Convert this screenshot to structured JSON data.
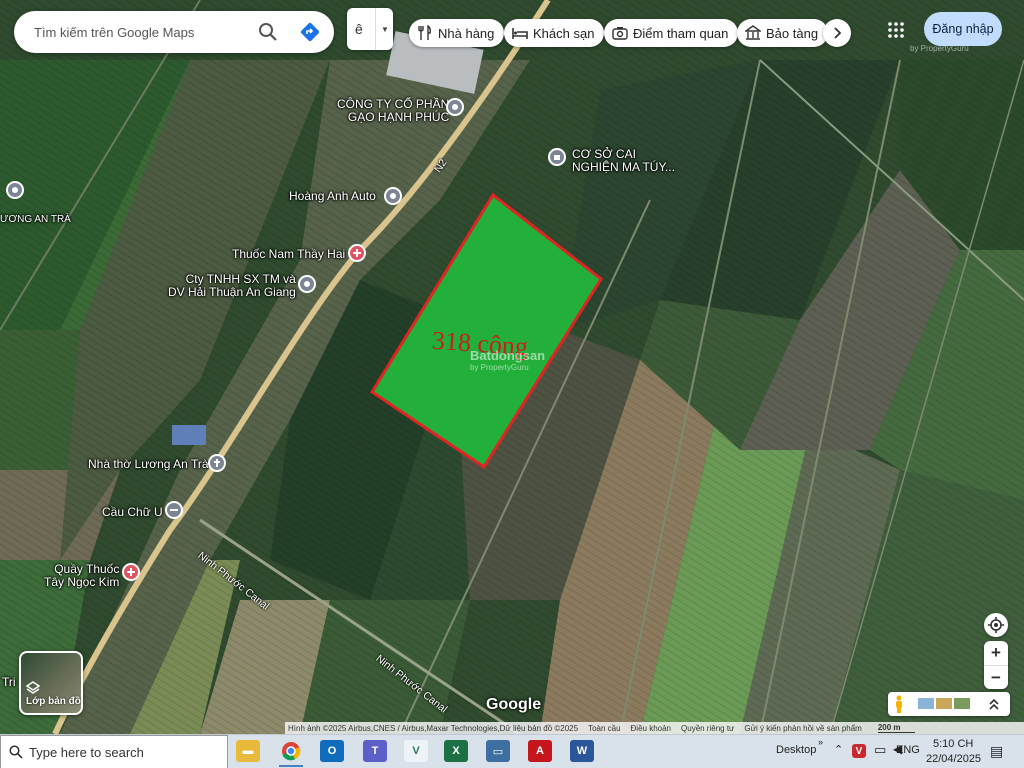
{
  "search": {
    "placeholder": "Tìm kiếm trên Google Maps"
  },
  "language_button": {
    "label": "ê"
  },
  "categories": [
    {
      "label": "Nhà hàng",
      "icon": "restaurant-icon"
    },
    {
      "label": "Khách sạn",
      "icon": "hotel-icon"
    },
    {
      "label": "Điểm tham quan",
      "icon": "camera-icon"
    },
    {
      "label": "Bảo tàng",
      "icon": "museum-icon"
    }
  ],
  "signin": {
    "label": "Đăng nhập"
  },
  "places": [
    {
      "name": "CÔNG TY CỔ PHẦN",
      "name2": "GẠO HẠNH PHÚC",
      "pin_color": "#7b8594"
    },
    {
      "name": "CƠ SỞ CAI",
      "name2": "NGHIỆN MA TÚY...",
      "pin_color": "#7b8594"
    },
    {
      "name": "Hoàng Anh Auto",
      "pin_color": "#7b8594"
    },
    {
      "name": "Thuốc Nam Thầy Hai",
      "pin_color": "#e05260"
    },
    {
      "name": "Cty TNHH SX TM và",
      "name2": "DV Hải Thuận An Giang",
      "pin_color": "#7b8594"
    },
    {
      "name": "Nhà thờ Lương An Trà",
      "pin_color": "#7b8594"
    },
    {
      "name": "Cầu Chữ U",
      "pin_color": "#7b8594"
    },
    {
      "name": "Quầy Thuốc",
      "name2": "Tây Ngọc Kim",
      "pin_color": "#e05260"
    },
    {
      "name": "ƯƠNG AN TRÀ",
      "pin_color": "#7b8594"
    },
    {
      "name": "Tri",
      "pin_color": "#7b8594"
    }
  ],
  "roads": {
    "n2": "N2",
    "canal_1": "Ninh Phước Canal",
    "canal_2": "Ninh Phước Canal"
  },
  "parcel": {
    "label": "318 công",
    "outline_color": "#e02424",
    "fill_color": "#22b03a"
  },
  "watermarks": {
    "brand": "Batdongsan",
    "sub": "by PropertyGuru"
  },
  "map_layers": {
    "label": "Lớp bản đồ"
  },
  "google_logo": "Google",
  "attribution": {
    "imagery": "Hình ảnh ©2025 Airbus,CNES / Airbus,Maxar Technologies,Dữ liệu bản đồ ©2025",
    "global": "Toàn cầu",
    "terms": "Điều khoản",
    "privacy": "Quyền riêng tư",
    "feedback": "Gửi ý kiến phản hồi về sản phẩm",
    "scale": "200 m"
  },
  "taskbar": {
    "search_placeholder": "Type here to search",
    "desktop": "Desktop",
    "language": "ENG",
    "time": "5:10 CH",
    "date": "22/04/2025"
  },
  "colors": {
    "signin_bg": "#c2dcff",
    "accent_blue": "#1a73e8"
  }
}
